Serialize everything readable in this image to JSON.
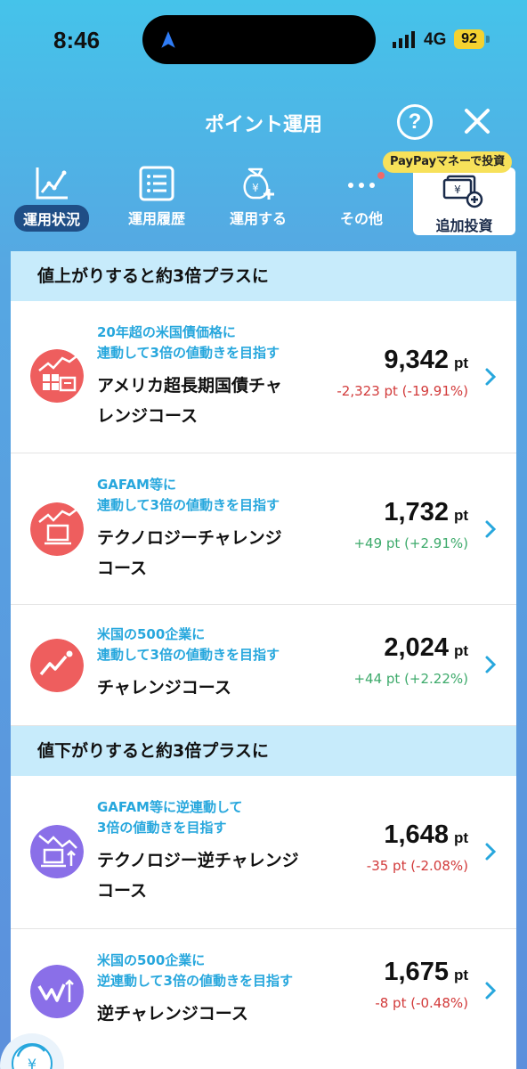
{
  "status_bar": {
    "time": "8:46",
    "network": "4G",
    "battery": "92"
  },
  "header": {
    "title": "ポイント運用",
    "help_label": "?"
  },
  "tabs": [
    {
      "label": "運用状況",
      "icon": "chart-line-icon",
      "active": true
    },
    {
      "label": "運用履歴",
      "icon": "list-icon",
      "active": false
    },
    {
      "label": "運用する",
      "icon": "money-bag-plus-icon",
      "active": false
    },
    {
      "label": "その他",
      "icon": "more-dots-icon",
      "active": false
    },
    {
      "label": "追加投資",
      "icon": "cash-plus-icon",
      "active": false
    }
  ],
  "promo_badge": "PayPayマネーで投資",
  "sections": [
    {
      "title": "値上がりすると約3倍プラスに",
      "items": [
        {
          "sub_lines": [
            "20年超の米国債価格に",
            "連動して3倍の値動きを目指す"
          ],
          "name_lines": [
            "アメリカ超長期国債チャ",
            "レンジコース"
          ],
          "value": "9,342",
          "unit": "pt",
          "change": "-2,323 pt (-19.91%)",
          "trend": "neg",
          "icon_color": "#ee5e5e"
        },
        {
          "sub_lines": [
            "GAFAM等に",
            "連動して3倍の値動きを目指す"
          ],
          "name_lines": [
            "テクノロジーチャレンジ",
            "コース"
          ],
          "value": "1,732",
          "unit": "pt",
          "change": "+49 pt (+2.91%)",
          "trend": "pos",
          "icon_color": "#ee5e5e"
        },
        {
          "sub_lines": [
            "米国の500企業に",
            "連動して3倍の値動きを目指す"
          ],
          "name_lines": [
            "チャレンジコース"
          ],
          "value": "2,024",
          "unit": "pt",
          "change": "+44 pt (+2.22%)",
          "trend": "pos",
          "icon_color": "#ee5e5e"
        }
      ]
    },
    {
      "title": "値下がりすると約3倍プラスに",
      "items": [
        {
          "sub_lines": [
            "GAFAM等に逆連動して",
            "3倍の値動きを目指す"
          ],
          "name_lines": [
            "テクノロジー逆チャレンジ",
            "コース"
          ],
          "value": "1,648",
          "unit": "pt",
          "change": "-35 pt (-2.08%)",
          "trend": "neg",
          "icon_color": "#8a6fe8"
        },
        {
          "sub_lines": [
            "米国の500企業に",
            "逆連動して3倍の値動きを目指す"
          ],
          "name_lines": [
            "逆チャレンジコース"
          ],
          "value": "1,675",
          "unit": "pt",
          "change": "-8 pt (-0.48%)",
          "trend": "neg",
          "icon_color": "#8a6fe8"
        }
      ]
    }
  ],
  "colors": {
    "accent_blue": "#27a7dd",
    "negative": "#d23a3a",
    "positive": "#3daa6b",
    "section_bg": "#c7ebfb",
    "active_tab_bg": "#1f4e86",
    "badge_yellow": "#f7e15a"
  }
}
